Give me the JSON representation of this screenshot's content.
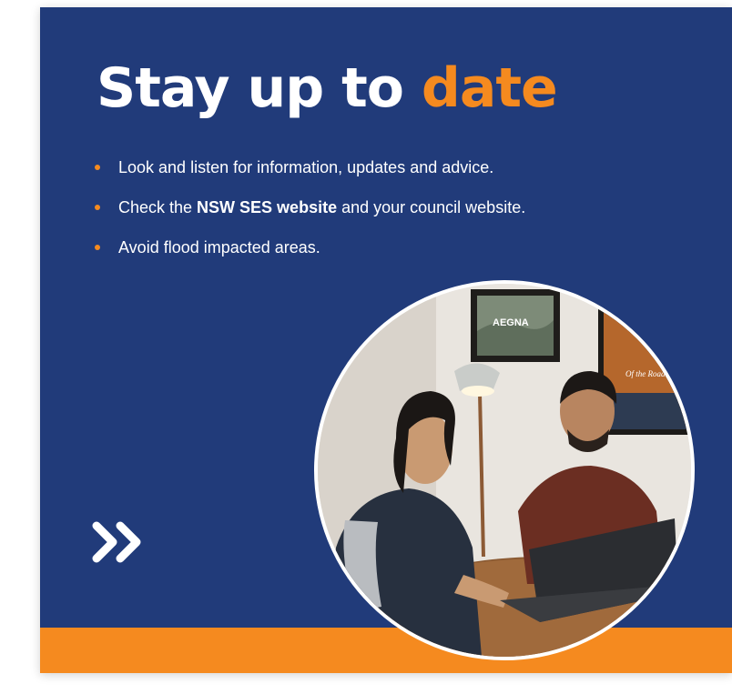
{
  "title": {
    "main": "Stay up to ",
    "accent": "date"
  },
  "bullets": [
    {
      "text": "Look and listen for information, updates and advice."
    },
    {
      "pre": "Check the ",
      "bold": "NSW SES website",
      "post": " and your council website."
    },
    {
      "text": "Avoid flood impacted areas."
    }
  ],
  "photo": {
    "poster_text": "AEGNA",
    "poster2_text": "Of the Road"
  },
  "icons": {
    "bullet": "bullet-dot-icon",
    "next": "double-chevron-right-icon"
  },
  "colors": {
    "background": "#213b7a",
    "accent": "#f58a1f",
    "text": "#ffffff"
  }
}
